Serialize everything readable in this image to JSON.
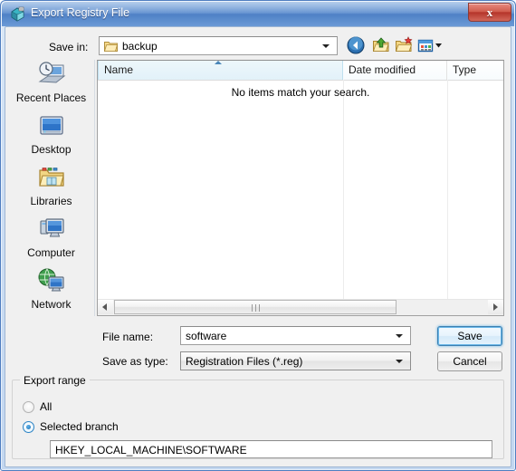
{
  "window": {
    "title": "Export Registry File",
    "title_icon": "registry-editor-icon",
    "close_label": "x",
    "accent_blue": "#4f81c6",
    "close_red": "#b5352a"
  },
  "toolbar": {
    "save_in_label": "Save in:",
    "current_folder": "backup",
    "folder_icon": "folder-icon",
    "buttons": [
      {
        "name": "back-button",
        "icon": "back-arrow-icon",
        "tooltip": "Back"
      },
      {
        "name": "up-one-level-button",
        "icon": "up-folder-icon",
        "tooltip": "Up One Level"
      },
      {
        "name": "new-folder-button",
        "icon": "new-folder-icon",
        "tooltip": "Create New Folder"
      },
      {
        "name": "views-button",
        "icon": "views-icon",
        "tooltip": "Views"
      }
    ]
  },
  "places": [
    {
      "label": "Recent Places",
      "icon": "recent-places-icon"
    },
    {
      "label": "Desktop",
      "icon": "desktop-icon"
    },
    {
      "label": "Libraries",
      "icon": "libraries-icon"
    },
    {
      "label": "Computer",
      "icon": "computer-icon"
    },
    {
      "label": "Network",
      "icon": "network-icon"
    }
  ],
  "file_list": {
    "columns": [
      {
        "label": "Name",
        "sorted": true,
        "sort_direction": "ascending"
      },
      {
        "label": "Date modified",
        "sorted": false
      },
      {
        "label": "Type",
        "sorted": false
      }
    ],
    "rows": [],
    "empty_message": "No items match your search.",
    "scrollbar": {
      "orientation": "horizontal",
      "left_arrow": "left-arrow-icon",
      "right_arrow": "right-arrow-icon"
    }
  },
  "form": {
    "file_name_label": "File name:",
    "file_name_value": "software",
    "save_as_type_label": "Save as type:",
    "save_as_type_value": "Registration Files (*.reg)",
    "save_button": "Save",
    "cancel_button": "Cancel"
  },
  "export_range": {
    "group_title": "Export range",
    "options": [
      {
        "label": "All",
        "selected": false
      },
      {
        "label": "Selected branch",
        "selected": true
      }
    ],
    "branch_value": "HKEY_LOCAL_MACHINE\\SOFTWARE"
  }
}
